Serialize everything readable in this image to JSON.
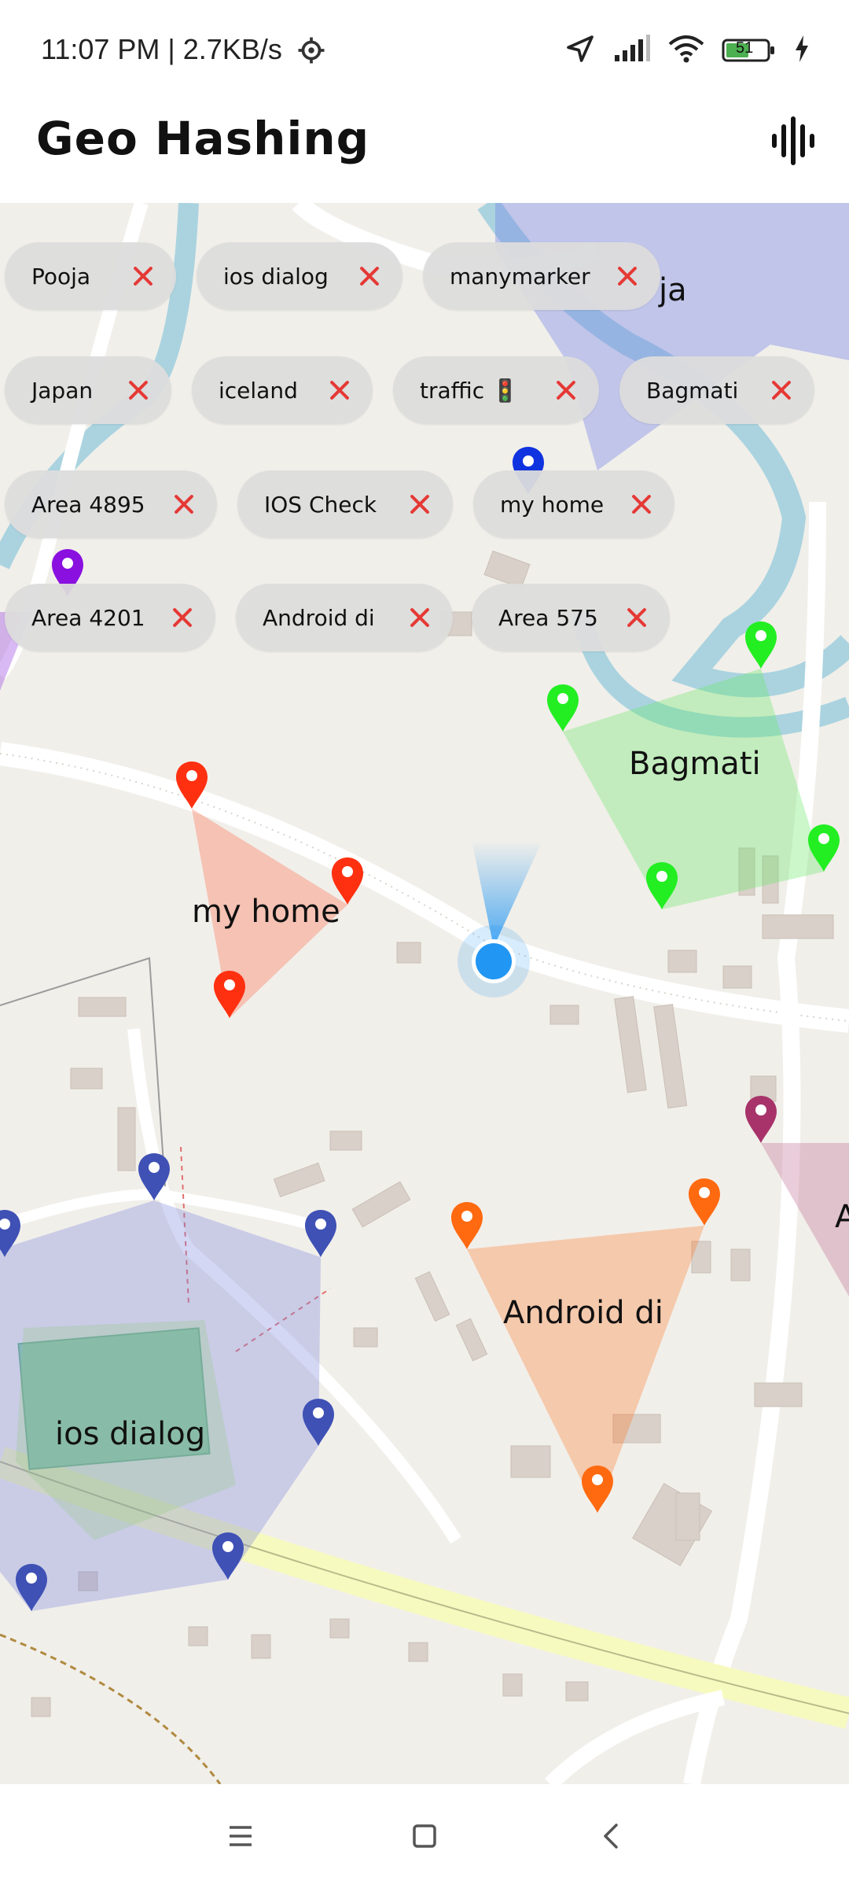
{
  "status": {
    "time": "11:07 PM | 2.7KB/s",
    "battery": "51"
  },
  "app": {
    "title": "Geo Hashing"
  },
  "chips": [
    {
      "label": "Pooja"
    },
    {
      "label": "ios dialog"
    },
    {
      "label": "manymarker"
    },
    {
      "label": "Japan"
    },
    {
      "label": "iceland"
    },
    {
      "label": "traffic 🚦"
    },
    {
      "label": "Bagmati"
    },
    {
      "label": "Area 4895"
    },
    {
      "label": "IOS Check"
    },
    {
      "label": "my home"
    },
    {
      "label": "Area 4201"
    },
    {
      "label": "Android di"
    },
    {
      "label": "Area 575"
    }
  ],
  "map_labels": {
    "pooja_partial": "ja",
    "bagmati": "Bagmati",
    "my_home": "my home",
    "android_di": "Android di",
    "ios_dialog": "ios dialog",
    "edge_partial": "A"
  },
  "colors": {
    "chip_bg": "#dcdcdc",
    "chip_close": "#e53935",
    "my_home": "#ff3010",
    "bagmati": "#22ee22",
    "android_di": "#ff6a10",
    "ios_dialog": "#3f51b5",
    "location": "#2196f3"
  }
}
